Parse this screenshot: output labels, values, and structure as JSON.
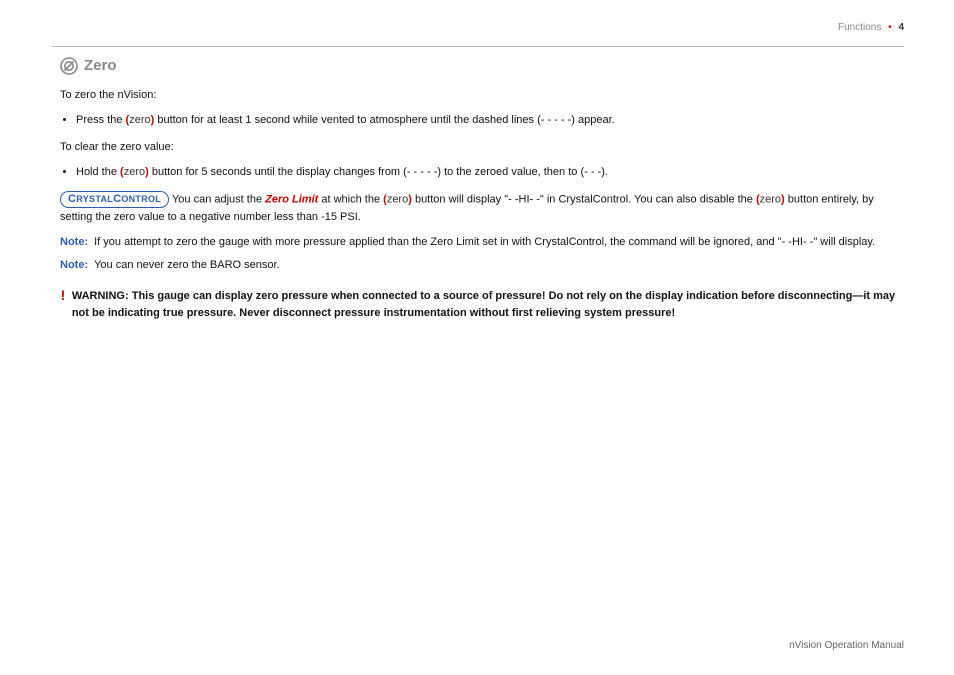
{
  "header": {
    "section": "Functions",
    "page": "4"
  },
  "title": "Zero",
  "intro": "To zero the nVision:",
  "bullet1_a": "Press the ",
  "bullet1_b": " button for at least 1 second while vented to atmosphere until the dashed lines (- - - - -) appear.",
  "clear_intro": "To clear the zero value:",
  "bullet2_a": "Hold the ",
  "bullet2_b": " button for 5 seconds until the display changes from (- - - - -) to the zeroed value, then to (- - -).",
  "zero_btn": "zero",
  "zero_limit": "Zero Limit",
  "cc_para_a": " You can adjust the ",
  "cc_para_b": " at which the ",
  "cc_para_c": " button will display \"- -HI- -\" in CrystalControl. You can also disable the ",
  "cc_para_d": " button entirely, by setting the zero value to a negative number less than -15 PSI.",
  "note_label": "Note:",
  "note1": "If you attempt to zero the gauge with more pressure applied than the Zero Limit set in with CrystalControl, the command will be ignored, and \"- -HI- -\" will display.",
  "note2": "You can never zero the BARO sensor.",
  "warn_label": "WARNING:",
  "warn_body": "This gauge can display zero pressure when connected to a source of pressure! Do not rely on the display indication before disconnecting—it may not be indicating true pressure. Never disconnect pressure instrumentation without first relieving system pressure!",
  "cc_pill": {
    "c1": "C",
    "mid1": "RYSTAL",
    "c2": "C",
    "mid2": "ONTROL"
  },
  "footer": "nVision Operation Manual"
}
